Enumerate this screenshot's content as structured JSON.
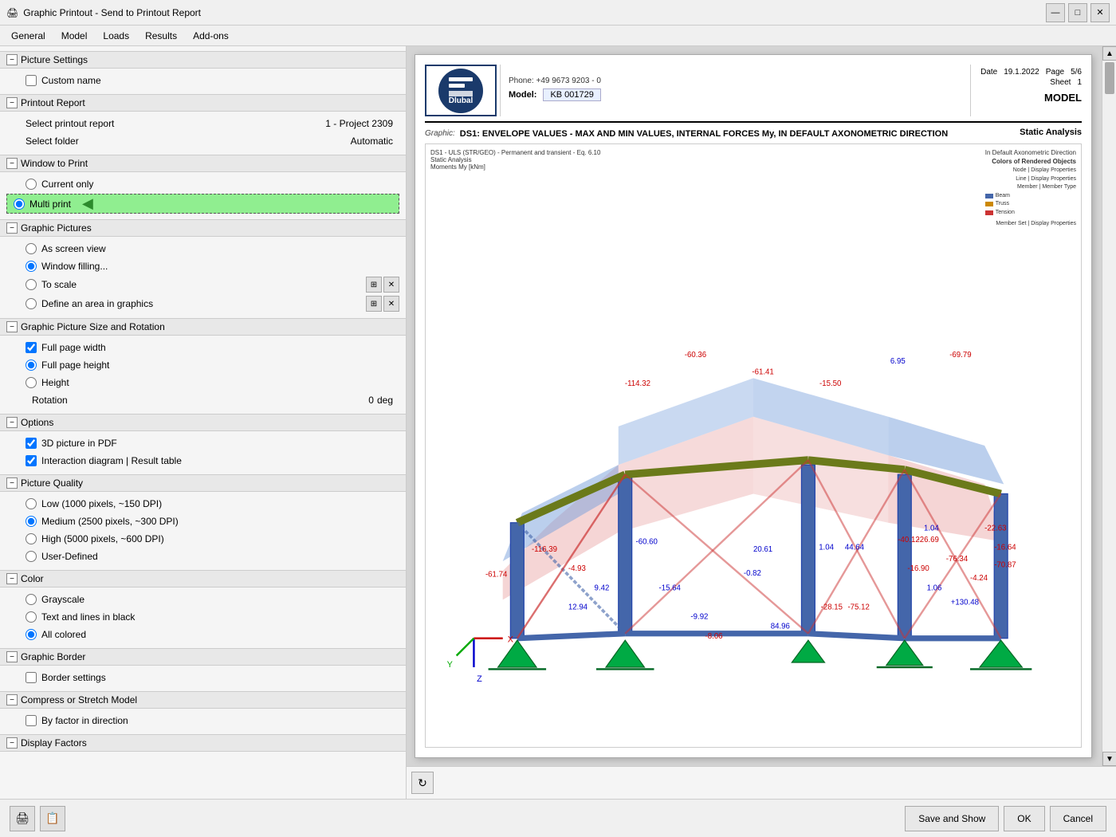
{
  "titleBar": {
    "icon": "🖨",
    "title": "Graphic Printout - Send to Printout Report",
    "minimize": "—",
    "maximize": "□",
    "close": "✕"
  },
  "menuBar": {
    "items": [
      "General",
      "Model",
      "Loads",
      "Results",
      "Add-ons"
    ]
  },
  "leftPanel": {
    "sections": [
      {
        "id": "picture-settings",
        "label": "Picture Settings",
        "collapsed": false,
        "items": [
          {
            "type": "checkbox",
            "label": "Custom name",
            "checked": false
          }
        ]
      },
      {
        "id": "printout-report",
        "label": "Printout Report",
        "collapsed": false,
        "items": [
          {
            "type": "row",
            "label": "Select printout report",
            "value": "1 - Project 2309"
          },
          {
            "type": "row",
            "label": "Select folder",
            "value": "Automatic"
          }
        ]
      },
      {
        "id": "window-to-print",
        "label": "Window to Print",
        "collapsed": false,
        "items": [
          {
            "type": "radio",
            "name": "window",
            "label": "Current only",
            "checked": false
          },
          {
            "type": "radio",
            "name": "window",
            "label": "Multi print",
            "checked": true,
            "highlighted": true
          }
        ]
      },
      {
        "id": "graphic-pictures",
        "label": "Graphic Pictures",
        "collapsed": false,
        "items": [
          {
            "type": "radio-icon",
            "name": "gp",
            "label": "As screen view",
            "checked": false
          },
          {
            "type": "radio-icon",
            "name": "gp",
            "label": "Window filling...",
            "checked": true
          },
          {
            "type": "radio-icon",
            "name": "gp",
            "label": "To scale",
            "checked": false
          },
          {
            "type": "radio-icon",
            "name": "gp",
            "label": "Define an area in graphics",
            "checked": false
          }
        ]
      },
      {
        "id": "graphic-picture-size",
        "label": "Graphic Picture Size and Rotation",
        "collapsed": false,
        "items": [
          {
            "type": "checkbox",
            "label": "Full page width",
            "checked": true
          },
          {
            "type": "radio",
            "name": "gpsize",
            "label": "Full page height",
            "checked": true
          },
          {
            "type": "radio",
            "name": "gpsize",
            "label": "Height",
            "checked": false
          },
          {
            "type": "rotation",
            "label": "Rotation",
            "value": "0",
            "unit": "deg"
          }
        ]
      },
      {
        "id": "options",
        "label": "Options",
        "collapsed": false,
        "items": [
          {
            "type": "checkbox",
            "label": "3D picture in PDF",
            "checked": true
          },
          {
            "type": "checkbox",
            "label": "Interaction diagram | Result table",
            "checked": true
          }
        ]
      },
      {
        "id": "picture-quality",
        "label": "Picture Quality",
        "collapsed": false,
        "items": [
          {
            "type": "radio",
            "name": "pq",
            "label": "Low (1000 pixels, ~150 DPI)",
            "checked": false
          },
          {
            "type": "radio",
            "name": "pq",
            "label": "Medium (2500 pixels, ~300 DPI)",
            "checked": true
          },
          {
            "type": "radio",
            "name": "pq",
            "label": "High (5000 pixels, ~600 DPI)",
            "checked": false
          },
          {
            "type": "radio",
            "name": "pq",
            "label": "User-Defined",
            "checked": false
          }
        ]
      },
      {
        "id": "color",
        "label": "Color",
        "collapsed": false,
        "items": [
          {
            "type": "radio",
            "name": "col",
            "label": "Grayscale",
            "checked": false
          },
          {
            "type": "radio",
            "name": "col",
            "label": "Text and lines in black",
            "checked": false
          },
          {
            "type": "radio",
            "name": "col",
            "label": "All colored",
            "checked": true
          }
        ]
      },
      {
        "id": "graphic-border",
        "label": "Graphic Border",
        "collapsed": false,
        "items": [
          {
            "type": "checkbox",
            "label": "Border settings",
            "checked": false
          }
        ]
      },
      {
        "id": "compress-stretch",
        "label": "Compress or Stretch Model",
        "collapsed": false,
        "items": [
          {
            "type": "checkbox",
            "label": "By factor in direction",
            "checked": false
          }
        ]
      },
      {
        "id": "display-factors",
        "label": "Display Factors",
        "collapsed": false,
        "items": []
      }
    ]
  },
  "preview": {
    "model": "KB 001729",
    "date": "19.1.2022",
    "page": "5/6",
    "sheet": "1",
    "section": "MODEL",
    "phone": "Phone: +49 9673 9203 - 0",
    "graphicLabel": "Graphic:",
    "graphicTitle": "DS1: ENVELOPE VALUES - MAX AND MIN VALUES, INTERNAL FORCES My, IN DEFAULT AXONOMETRIC DIRECTION",
    "analysisType": "Static Analysis",
    "subLabel": "DS1 - ULS (STR/GEO) - Permanent and transient - Eq. 6.10",
    "subLabel2": "Static Analysis",
    "subLabel3": "Moments My [kNm]",
    "defaultAxo": "In Default Axonometric Direction",
    "colorsLabel": "Colors of Rendered Objects",
    "legend": [
      {
        "color": "#888888",
        "label": "Node | Display Properties"
      },
      {
        "color": "#555555",
        "label": "Line | Display Properties"
      },
      {
        "color": "#aa00aa",
        "label": "Member | Member Type"
      },
      {
        "color": "#4466aa",
        "label": "Beam"
      },
      {
        "color": "#cc6600",
        "label": "Truss"
      },
      {
        "color": "#aa2222",
        "label": "Tension"
      }
    ],
    "memberSetLabel": "Member Set | Display Properties"
  },
  "bottomBar": {
    "leftIcons": [
      "🖨",
      "📋"
    ],
    "buttons": {
      "saveAndShow": "Save and Show",
      "ok": "OK",
      "cancel": "Cancel"
    }
  },
  "refreshButton": "↻"
}
